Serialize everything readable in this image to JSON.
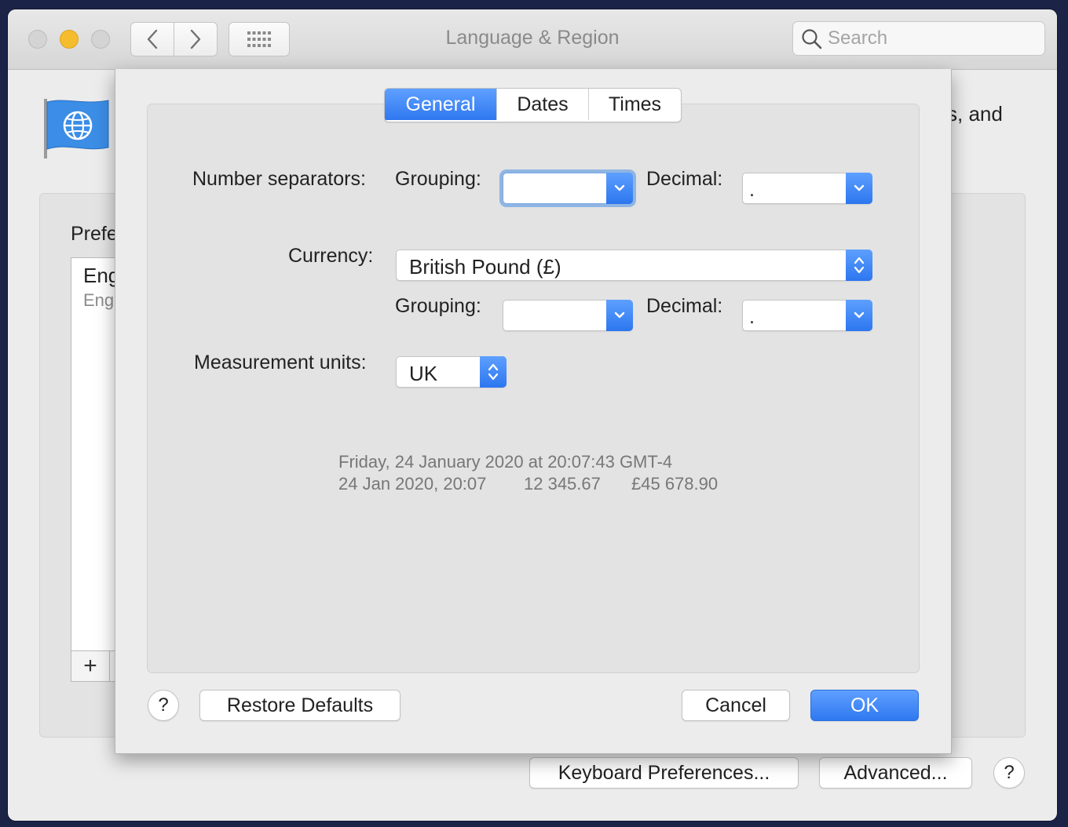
{
  "window": {
    "title": "Language & Region",
    "search_placeholder": "Search"
  },
  "background": {
    "header_fragment": "s, and",
    "preferred_label": "Prefe",
    "language_primary": "Eng",
    "language_secondary": "Eng",
    "add_symbol": "+",
    "keyboard_button": "Keyboard Preferences...",
    "advanced_button": "Advanced...",
    "help_symbol": "?"
  },
  "sheet": {
    "tabs": [
      "General",
      "Dates",
      "Times"
    ],
    "active_tab": "General",
    "number_separators_label": "Number separators:",
    "grouping_label": "Grouping:",
    "decimal_label": "Decimal:",
    "number_grouping_value": "",
    "number_decimal_value": ".",
    "currency_label": "Currency:",
    "currency_value": "British Pound (£)",
    "currency_grouping_label": "Grouping:",
    "currency_decimal_label": "Decimal:",
    "currency_grouping_value": "",
    "currency_decimal_value": ".",
    "measurement_label": "Measurement units:",
    "measurement_value": "UK",
    "sample_line1": "Friday, 24 January 2020 at 20:07:43 GMT-4",
    "sample_date_short": "24 Jan 2020, 20:07",
    "sample_number": "12 345.67",
    "sample_currency": "£45 678.90",
    "help_symbol": "?",
    "restore_button": "Restore Defaults",
    "cancel_button": "Cancel",
    "ok_button": "OK"
  },
  "colors": {
    "accent": "#2f78f0",
    "desktop": "#1b2347",
    "minimize": "#f5bd2e"
  }
}
